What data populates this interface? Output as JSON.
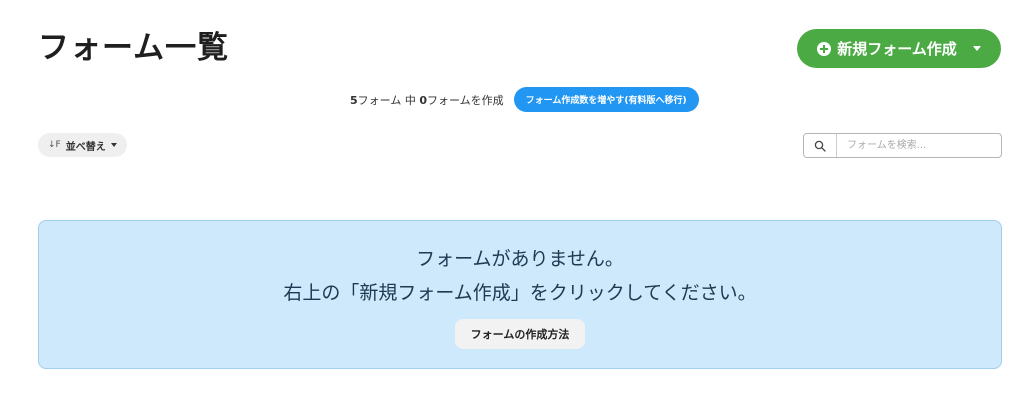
{
  "header": {
    "title": "フォーム一覧",
    "new_form_button_label": "新規フォーム作成"
  },
  "usage": {
    "count_text": "5",
    "count_suffix": "フォーム 中 ",
    "created_count": "0",
    "created_suffix": "フォームを作成",
    "upgrade_label": "フォーム作成数を増やす(有料版へ移行)"
  },
  "toolbar": {
    "sort_icon": "↓F",
    "sort_label": "並べ替え",
    "search_placeholder": "フォームを検索..."
  },
  "empty_state": {
    "line1": "フォームがありません。",
    "line2": "右上の「新規フォーム作成」をクリックしてください。",
    "howto_label": "フォームの作成方法"
  },
  "colors": {
    "primary_green": "#4caa45",
    "upgrade_blue": "#2196f3",
    "panel_background": "#cde9fb"
  }
}
